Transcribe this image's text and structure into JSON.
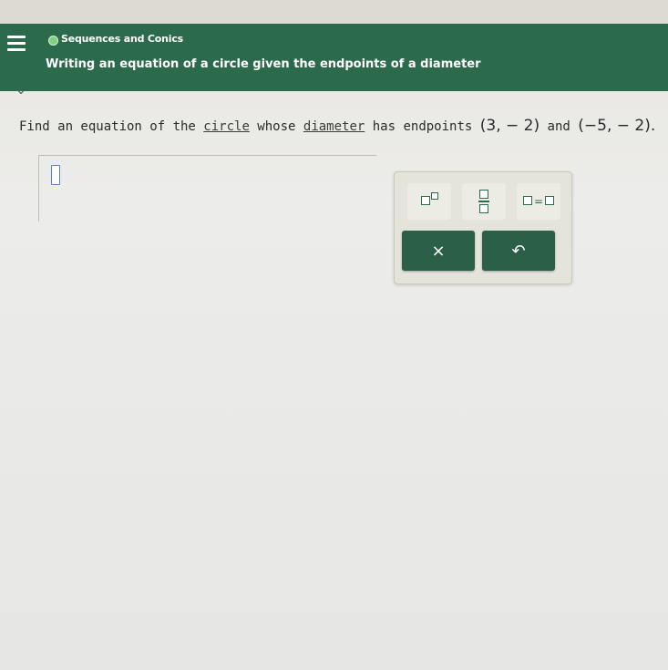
{
  "header": {
    "topic": "Sequences and Conics",
    "title": "Writing an equation of a circle given the endpoints of a diameter",
    "menu_icon": "hamburger-menu-icon",
    "status_icon": "status-dot-icon",
    "color": "#2b6b4b"
  },
  "collapse": {
    "icon": "chevron-down-icon",
    "glyph": "⌄"
  },
  "question": {
    "part1": "Find an equation of the ",
    "term1": "circle",
    "part2": " whose ",
    "term2": "diameter",
    "part3": " has endpoints ",
    "point1": "(3, − 2)",
    "part4": " and ",
    "point2": "(−5, − 2)",
    "part5": "."
  },
  "answer": {
    "value": ""
  },
  "keypad": {
    "keys": [
      {
        "name": "superscript-key",
        "icon": "superscript-icon"
      },
      {
        "name": "fraction-key",
        "icon": "fraction-icon"
      },
      {
        "name": "equals-key",
        "icon": "equation-icon",
        "symbol": "="
      }
    ],
    "clear_label": "×",
    "undo_label": "↶",
    "action_color": "#2b5f47"
  }
}
